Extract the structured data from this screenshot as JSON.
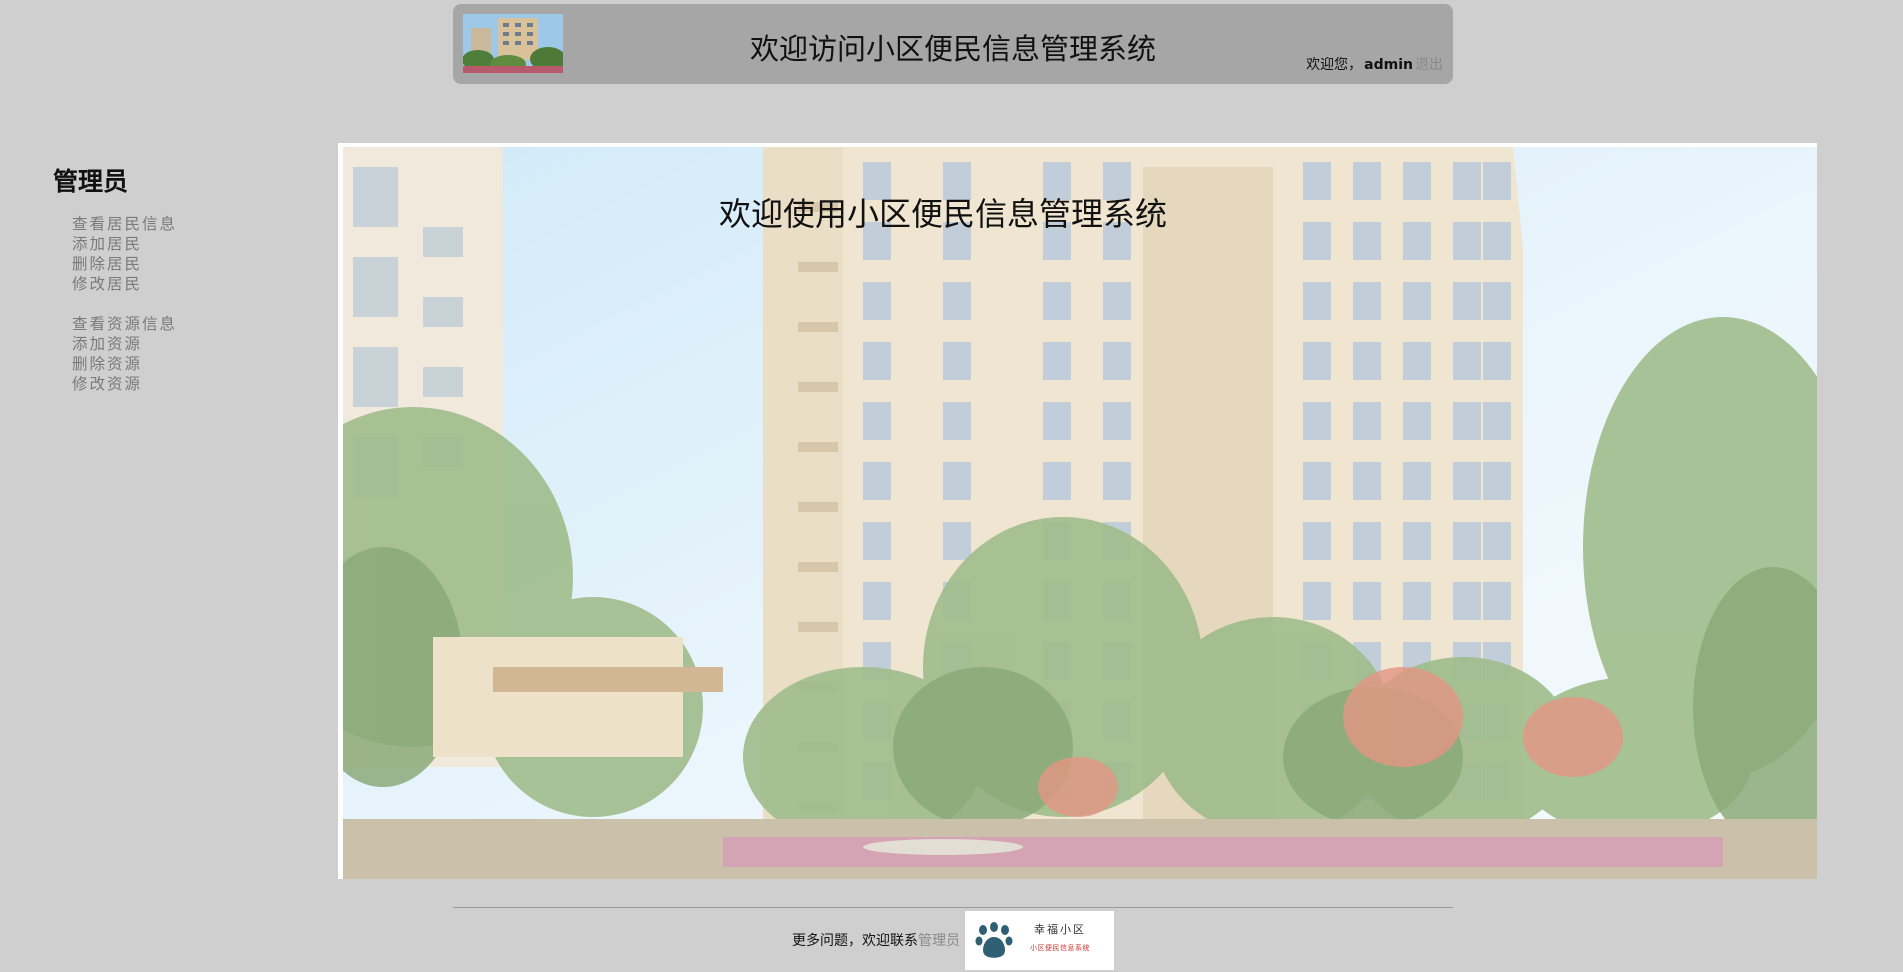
{
  "header": {
    "title": "欢迎访问小区便民信息管理系统",
    "welcome_prefix": "欢迎您，",
    "username": "admin",
    "logout_label": "退出"
  },
  "sidebar": {
    "heading": "管理员",
    "resident_group": [
      {
        "label": "查看居民信息"
      },
      {
        "label": "添加居民"
      },
      {
        "label": "删除居民"
      },
      {
        "label": "修改居民"
      }
    ],
    "resource_group": [
      {
        "label": "查看资源信息"
      },
      {
        "label": "添加资源"
      },
      {
        "label": "删除资源"
      },
      {
        "label": "修改资源"
      }
    ]
  },
  "main": {
    "banner_title": "欢迎使用小区便民信息管理系统"
  },
  "footer": {
    "text": "更多问题，欢迎联系",
    "admin_link": "管理员",
    "logo": {
      "icon": "paw-icon",
      "name": "幸福小区",
      "subtitle": "小区便民信息系统"
    }
  },
  "colors": {
    "page_background": "#cfcfcf",
    "header_background": "#a6a6a6",
    "link_gray": "#7a7a7a",
    "logo_subtitle_red": "#d0312d"
  }
}
